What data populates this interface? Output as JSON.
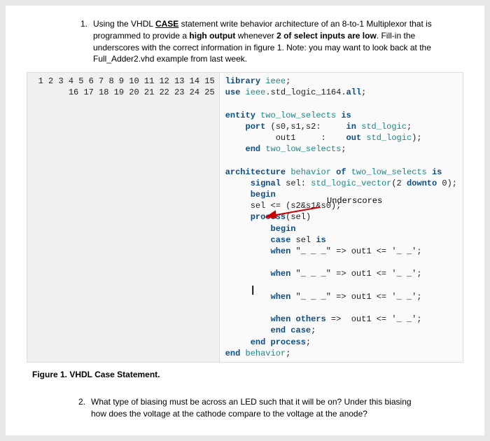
{
  "q1": {
    "num": "1.",
    "parts": [
      "Using the VHDL ",
      "CASE",
      " statement write behavior architecture of an 8-to-1 Multiplexor that is programmed to provide a ",
      "high output",
      " whenever ",
      "2 of select inputs are low",
      ". Fill-in the underscores with the correct information in figure 1. Note: you may want to look back at the Full_Adder2.vhd example from last week."
    ]
  },
  "code": {
    "line_numbers": [
      "1",
      "2",
      "3",
      "4",
      "5",
      "6",
      "7",
      "8",
      "9",
      "10",
      "11",
      "12",
      "13",
      "14",
      "15",
      "16",
      "17",
      "18",
      "19",
      "20",
      "21",
      "22",
      "23",
      "24",
      "25"
    ],
    "lines": [
      {
        "t": [
          [
            "kw-blue",
            "library "
          ],
          [
            "kw-teal",
            "ieee"
          ],
          [
            "",
            "; "
          ]
        ]
      },
      {
        "t": [
          [
            "kw-blue",
            "use "
          ],
          [
            "kw-teal",
            "ieee"
          ],
          [
            "",
            ".std_logic_1164."
          ],
          [
            "kw-blue",
            "all"
          ],
          [
            "",
            ";"
          ]
        ]
      },
      {
        "t": [
          [
            "",
            ""
          ]
        ]
      },
      {
        "t": [
          [
            "kw-blue",
            "entity "
          ],
          [
            "kw-teal",
            "two_low_selects"
          ],
          [
            "kw-blue",
            " is"
          ]
        ]
      },
      {
        "t": [
          [
            "",
            "    "
          ],
          [
            "kw-blue",
            "port "
          ],
          [
            "",
            "(s0,s1,s2:     "
          ],
          [
            "kw-blue",
            "in "
          ],
          [
            "kw-teal",
            "std_logic"
          ],
          [
            "",
            ";"
          ]
        ]
      },
      {
        "t": [
          [
            "",
            "          out1     :    "
          ],
          [
            "kw-blue",
            "out "
          ],
          [
            "kw-teal",
            "std_logic"
          ],
          [
            "",
            ");"
          ]
        ]
      },
      {
        "t": [
          [
            "",
            "    "
          ],
          [
            "kw-blue",
            "end "
          ],
          [
            "kw-teal",
            "two_low_selects"
          ],
          [
            "",
            ";"
          ]
        ]
      },
      {
        "t": [
          [
            "",
            ""
          ]
        ]
      },
      {
        "t": [
          [
            "kw-blue",
            "architecture "
          ],
          [
            "kw-teal",
            "behavior"
          ],
          [
            "kw-blue",
            " of "
          ],
          [
            "kw-teal",
            "two_low_selects"
          ],
          [
            "kw-blue",
            " is"
          ]
        ]
      },
      {
        "t": [
          [
            "",
            "     "
          ],
          [
            "kw-blue",
            "signal "
          ],
          [
            "",
            "sel: "
          ],
          [
            "kw-teal",
            "std_logic_vector"
          ],
          [
            "",
            "(2 "
          ],
          [
            "kw-blue",
            "downto"
          ],
          [
            "",
            ""
          ],
          [
            "",
            " 0);"
          ]
        ]
      },
      {
        "t": [
          [
            "",
            "     "
          ],
          [
            "kw-blue",
            "begin"
          ]
        ]
      },
      {
        "t": [
          [
            "",
            "     sel <= (s2&s1&s0);"
          ]
        ]
      },
      {
        "t": [
          [
            "",
            "     "
          ],
          [
            "kw-blue",
            "process"
          ],
          [
            "",
            "(sel)"
          ]
        ]
      },
      {
        "t": [
          [
            "",
            "         "
          ],
          [
            "kw-blue",
            "begin"
          ]
        ]
      },
      {
        "t": [
          [
            "",
            "         "
          ],
          [
            "kw-blue",
            "case "
          ],
          [
            "",
            "sel "
          ],
          [
            "kw-blue",
            "is"
          ]
        ]
      },
      {
        "t": [
          [
            "",
            "         "
          ],
          [
            "kw-blue",
            "when "
          ],
          [
            "",
            "\"_ _ _\" => out1 <= '_ _';"
          ]
        ]
      },
      {
        "t": [
          [
            "",
            ""
          ]
        ]
      },
      {
        "t": [
          [
            "",
            "         "
          ],
          [
            "kw-blue",
            "when "
          ],
          [
            "",
            "\"_ _ _\" => out1 <= '_ _';"
          ]
        ]
      },
      {
        "t": [
          [
            "",
            ""
          ]
        ]
      },
      {
        "t": [
          [
            "",
            "         "
          ],
          [
            "kw-blue",
            "when "
          ],
          [
            "",
            "\"_ _ _\" => out1 <= '_ _';"
          ]
        ]
      },
      {
        "t": [
          [
            "",
            ""
          ]
        ]
      },
      {
        "t": [
          [
            "",
            "         "
          ],
          [
            "kw-blue",
            "when others "
          ],
          [
            "",
            "=>  out1 <= '_ _';"
          ]
        ]
      },
      {
        "t": [
          [
            "",
            "         "
          ],
          [
            "kw-blue",
            "end case"
          ],
          [
            "",
            ";"
          ]
        ]
      },
      {
        "t": [
          [
            "",
            "     "
          ],
          [
            "kw-blue",
            "end process"
          ],
          [
            "",
            ";"
          ]
        ]
      },
      {
        "t": [
          [
            "kw-blue",
            "end "
          ],
          [
            "kw-teal",
            "behavior"
          ],
          [
            "",
            ";"
          ]
        ]
      }
    ]
  },
  "annotation_label": "Underscores",
  "figure_caption": "Figure 1. VHDL Case Statement.",
  "q2": {
    "num": "2.",
    "text": "What type of biasing must be across an LED such that it will be on? Under this biasing how does the voltage at the cathode compare to the voltage at the anode?"
  }
}
